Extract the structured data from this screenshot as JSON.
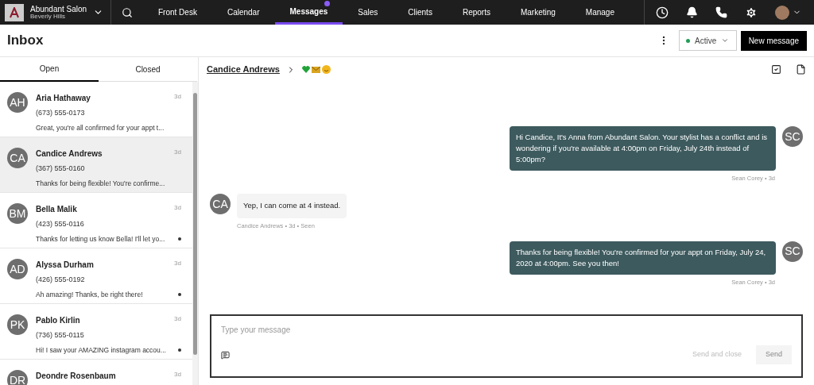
{
  "business": {
    "name": "Abundant Salon",
    "location": "Beverly Hills"
  },
  "nav": [
    {
      "label": "Front Desk",
      "selected": false,
      "badge": false
    },
    {
      "label": "Calendar",
      "selected": false,
      "badge": false
    },
    {
      "label": "Messages",
      "selected": true,
      "badge": true
    },
    {
      "label": "Sales",
      "selected": false,
      "badge": false
    },
    {
      "label": "Clients",
      "selected": false,
      "badge": false
    },
    {
      "label": "Reports",
      "selected": false,
      "badge": false
    },
    {
      "label": "Marketing",
      "selected": false,
      "badge": false
    },
    {
      "label": "Manage",
      "selected": false,
      "badge": false
    }
  ],
  "page_title": "Inbox",
  "status": {
    "label": "Active",
    "color": "#1f9d55"
  },
  "new_message_button": "New message",
  "tabs": [
    {
      "label": "Open",
      "selected": true
    },
    {
      "label": "Closed",
      "selected": false
    }
  ],
  "conversations": [
    {
      "initials": "AH",
      "name": "Aria Hathaway",
      "time": "3d",
      "phone": "(673) 555-0173",
      "preview": "Great, you're all confirmed for your appt t...",
      "selected": false,
      "unread": false
    },
    {
      "initials": "CA",
      "name": "Candice Andrews",
      "time": "3d",
      "phone": "(367) 555-0160",
      "preview": "Thanks for being flexible! You're confirme...",
      "selected": true,
      "unread": false
    },
    {
      "initials": "BM",
      "name": "Bella Malik",
      "time": "3d",
      "phone": "(423) 555-0116",
      "preview": "Thanks for letting us know Bella! I'll let yo...",
      "selected": false,
      "unread": true
    },
    {
      "initials": "AD",
      "name": "Alyssa Durham",
      "time": "3d",
      "phone": "(426) 555-0192",
      "preview": "Ah amazing! Thanks, be right there!",
      "selected": false,
      "unread": true
    },
    {
      "initials": "PK",
      "name": "Pablo Kirlin",
      "time": "3d",
      "phone": "(736) 555-0115",
      "preview": "Hi! I saw your AMAZING instagram accou...",
      "selected": false,
      "unread": true
    },
    {
      "initials": "DR",
      "name": "Deondre Rosenbaum",
      "time": "3d",
      "selected": false
    }
  ],
  "chat": {
    "contact": "Candice Andrews",
    "messages": [
      {
        "kind": "outgoing",
        "initials": "SC",
        "text": "Hi Candice, It's Anna from Abundant Salon. Your stylist has a conflict and is wondering if you're available at 4:00pm on Friday, July 24th instead of 5:00pm?",
        "meta": "Sean Corey • 3d"
      },
      {
        "kind": "incoming",
        "initials": "CA",
        "text": "Yep, I can come at 4 instead.",
        "meta": "Candice Andrews • 3d • Seen"
      },
      {
        "kind": "outgoing",
        "initials": "SC",
        "text": "Thanks for being flexible! You're confirmed for your appt on Friday, July 24, 2020 at 4:00pm. See you then!",
        "meta": "Sean Corey • 3d"
      }
    ],
    "composer": {
      "placeholder": "Type your message",
      "send_and_close": "Send and close",
      "send": "Send"
    }
  }
}
